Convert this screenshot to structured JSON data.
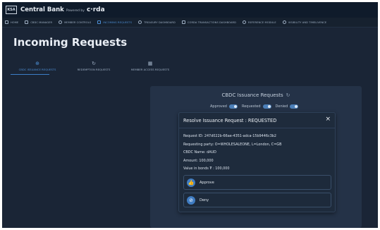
{
  "header": {
    "logo_text": "KSA",
    "app_name": "Central Bank",
    "powered_by": "Powered by",
    "vendor": "c·rda"
  },
  "nav": {
    "items": [
      {
        "label": "HOME",
        "icon": "home-icon"
      },
      {
        "label": "CBDC MANAGER",
        "icon": "wallet-icon"
      },
      {
        "label": "MEMBER CONTROLS",
        "icon": "gear-icon"
      },
      {
        "label": "INCOMING REQUESTS",
        "icon": "inbox-icon",
        "active": true
      },
      {
        "label": "TREASURY DASHBOARD",
        "icon": "cycle-icon"
      },
      {
        "label": "CORDA TRANSACTIONS DASHBOARD",
        "icon": "table-icon"
      },
      {
        "label": "REFERENCE MODULE",
        "icon": "network-icon"
      },
      {
        "label": "VISIBILITY AND TIMELIVENCE",
        "icon": "eye-icon"
      }
    ]
  },
  "page": {
    "title": "Incoming Requests"
  },
  "tabs": [
    {
      "label": "CBDC ISSUANCE REQUESTS",
      "icon": "issuance-icon",
      "active": true
    },
    {
      "label": "REDEMPTION REQUESTS",
      "icon": "redemption-icon"
    },
    {
      "label": "MEMBER ACCESS REQUESTS",
      "icon": "member-icon"
    }
  ],
  "panel": {
    "title": "CBDC Issuance Requests",
    "filters": [
      "Approved",
      "Requested",
      "Denied"
    ]
  },
  "modal": {
    "title": "Resolve Issuance Request : REQUESTED",
    "close": "×",
    "details": {
      "request_id": "Request ID: 247d022b-66ae-4351-adca-15b9446c3b2",
      "requesting_party": "Requesting party: O=WHOLESALEONE, L=London, C=GB",
      "cbdc_name": "CBDC Name: dAUD",
      "amount": "Amount: 100,000",
      "value_in_bonds": "Value in bonds ₮ : 100,000"
    },
    "approve_label": "Approve",
    "deny_label": "Deny"
  },
  "colors": {
    "accent": "#3f7cc2",
    "active_nav": "#4d8fd6",
    "background": "#1a2536"
  }
}
